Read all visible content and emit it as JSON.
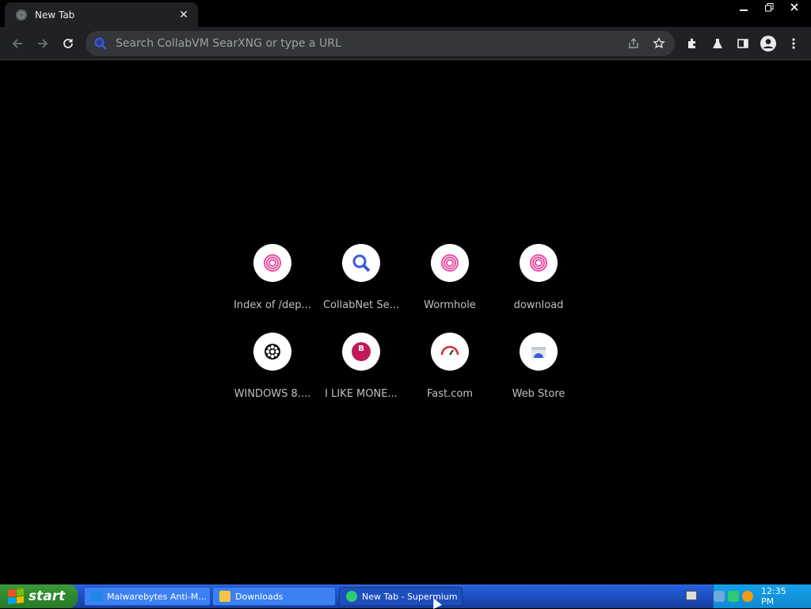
{
  "browser": {
    "tab": {
      "title": "New Tab",
      "close_glyph": "✕"
    },
    "window_controls": {
      "minimize": "—",
      "restore": "❐",
      "close": "✕"
    },
    "omnibox": {
      "placeholder": "Search CollabVM SearXNG or type a URL",
      "value": ""
    },
    "toolbar_icons": [
      "back-icon",
      "forward-icon",
      "reload-icon",
      "share-icon",
      "bookmark-star-icon",
      "extensions-icon",
      "labs-flask-icon",
      "side-panel-icon",
      "profile-icon",
      "menu-icon"
    ]
  },
  "shortcuts": [
    {
      "label": "Index of /dep...",
      "icon": "spiral-icon"
    },
    {
      "label": "CollabNet Se...",
      "icon": "magnifier-icon"
    },
    {
      "label": "Wormhole",
      "icon": "spiral-icon"
    },
    {
      "label": "download",
      "icon": "spiral-icon"
    },
    {
      "label": "WINDOWS 8....",
      "icon": "film-reel-icon"
    },
    {
      "label": "I LIKE MONE...",
      "icon": "b-badge-icon"
    },
    {
      "label": "Fast.com",
      "icon": "speedometer-icon"
    },
    {
      "label": "Web Store",
      "icon": "web-store-icon"
    }
  ],
  "taskbar": {
    "start_label": "start",
    "tasks": [
      {
        "label": "Malwarebytes Anti-M...",
        "active": false
      },
      {
        "label": "Downloads",
        "active": false
      },
      {
        "label": "New Tab - Supermium",
        "active": true
      }
    ],
    "clock": "12:35 PM"
  },
  "colors": {
    "spiral": "#e94aa0",
    "magnifier": "#3b5bdb",
    "badge": "#c2185b",
    "taskbar": "#245edb",
    "start": "#2e8b2e"
  }
}
